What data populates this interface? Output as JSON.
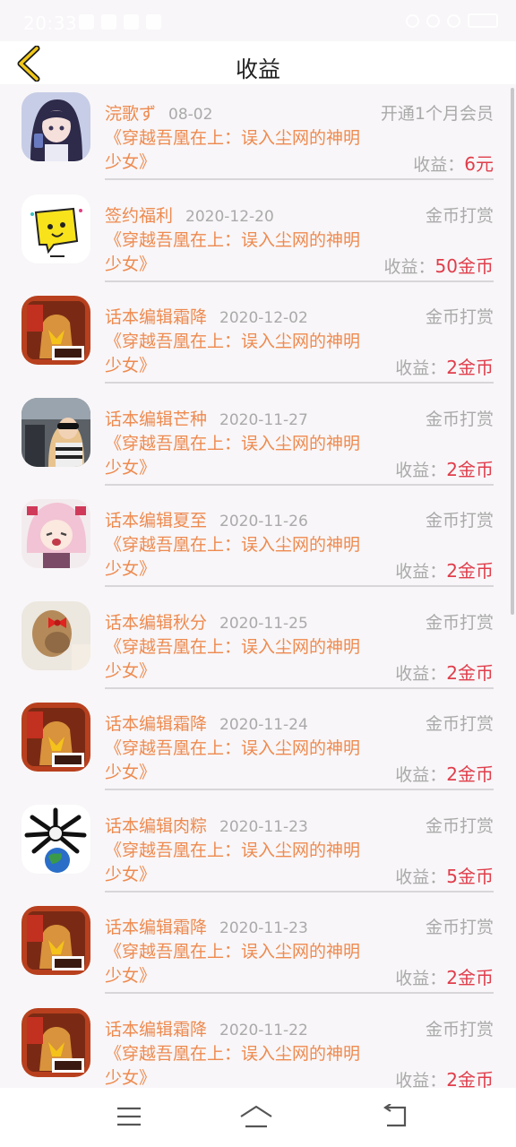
{
  "status_bar": {
    "time": "20:33"
  },
  "header": {
    "title": "收益",
    "back_icon": "chevron-left-icon"
  },
  "earn_label": "收益：",
  "items": [
    {
      "name": "浣歌ず",
      "date": "08-02",
      "type": "开通1个月会员",
      "book": "《穿越吾凰在上：误入尘网的神明少女》",
      "amount": "6元",
      "avatar": "girl-portrait"
    },
    {
      "name": "签约福利",
      "date": "2020-12-20",
      "type": "金币打赏",
      "book": "《穿越吾凰在上：误入尘网的神明少女》",
      "amount": "50金币",
      "avatar": "yellow-chat-icon"
    },
    {
      "name": "话本编辑霜降",
      "date": "2020-12-02",
      "type": "金币打赏",
      "book": "《穿越吾凰在上：误入尘网的神明少女》",
      "amount": "2金币",
      "avatar": "editor-badge"
    },
    {
      "name": "话本编辑芒种",
      "date": "2020-11-27",
      "type": "金币打赏",
      "book": "《穿越吾凰在上：误入尘网的神明少女》",
      "amount": "2金币",
      "avatar": "car-selfie"
    },
    {
      "name": "话本编辑夏至",
      "date": "2020-11-26",
      "type": "金币打赏",
      "book": "《穿越吾凰在上：误入尘网的神明少女》",
      "amount": "2金币",
      "avatar": "anime-girl"
    },
    {
      "name": "话本编辑秋分",
      "date": "2020-11-25",
      "type": "金币打赏",
      "book": "《穿越吾凰在上：误入尘网的神明少女》",
      "amount": "2金币",
      "avatar": "hair-bow"
    },
    {
      "name": "话本编辑霜降",
      "date": "2020-11-24",
      "type": "金币打赏",
      "book": "《穿越吾凰在上：误入尘网的神明少女》",
      "amount": "2金币",
      "avatar": "editor-badge"
    },
    {
      "name": "话本编辑肉粽",
      "date": "2020-11-23",
      "type": "金币打赏",
      "book": "《穿越吾凰在上：误入尘网的神明少女》",
      "amount": "5金币",
      "avatar": "earth-bones"
    },
    {
      "name": "话本编辑霜降",
      "date": "2020-11-23",
      "type": "金币打赏",
      "book": "《穿越吾凰在上：误入尘网的神明少女》",
      "amount": "2金币",
      "avatar": "editor-badge"
    },
    {
      "name": "话本编辑霜降",
      "date": "2020-11-22",
      "type": "金币打赏",
      "book": "《穿越吾凰在上：误入尘网的神明少女》",
      "amount": "2金币",
      "avatar": "editor-badge"
    }
  ],
  "nav_bar": {
    "menu_icon": "menu-icon",
    "home_icon": "home-icon",
    "back_icon": "back-icon"
  }
}
